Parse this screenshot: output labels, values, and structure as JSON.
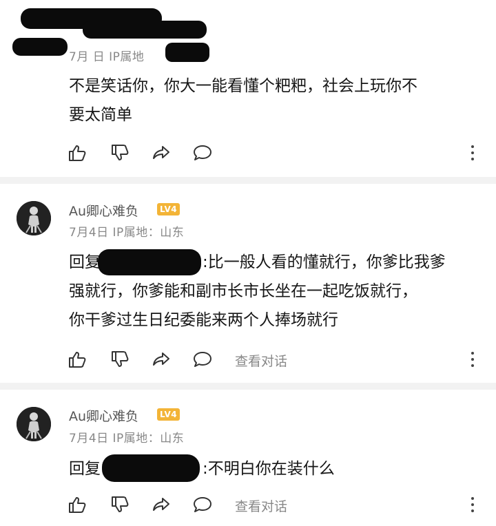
{
  "comments": [
    {
      "meta": "7月 日 IP属地",
      "text_line1": "不是笑话你，你大一能看懂个粑粑，社会上玩你不",
      "text_line2": "要太简单"
    },
    {
      "author": "Au卿心难负",
      "badge": "LV4",
      "meta": "7月4日 IP属地：山东",
      "reply_prefix": "回复",
      "text_line1": ":比一般人看的懂就行，你爹比我爹",
      "text_line2": "强就行，你爹能和副市长市长坐在一起吃饭就行，",
      "text_line3": "你干爹过生日纪委能来两个人捧场就行",
      "view_conversation": "查看对话"
    },
    {
      "author": "Au卿心难负",
      "badge": "LV4",
      "meta": "7月4日 IP属地：山东",
      "reply_prefix": "回复",
      "text_line1": ":不明白你在装什么",
      "view_conversation": "查看对话"
    }
  ],
  "icons": [
    "thumb-up-icon",
    "thumb-down-icon",
    "share-icon",
    "comment-icon",
    "more-vertical-icon"
  ]
}
